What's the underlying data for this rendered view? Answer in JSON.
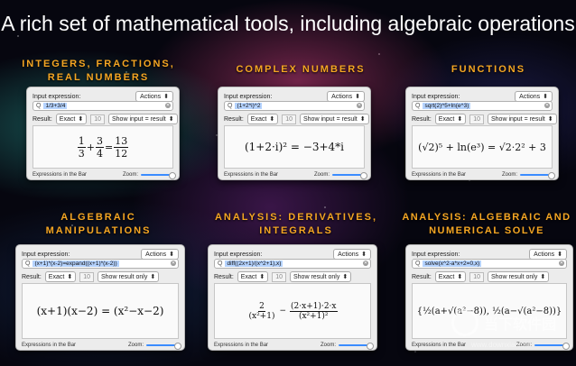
{
  "headline": "A rich set of mathematical tools, including algebraic operations",
  "common": {
    "input_label": "Input expression:",
    "actions_label": "Actions",
    "result_label": "Result:",
    "digits": "10",
    "expressions_in_bar": "Expressions in the Bar",
    "zoom_label": "Zoom:",
    "search_glyph": "Q",
    "clear_glyph": "✕",
    "dropdown_glyph": "⬍"
  },
  "sections": [
    {
      "label_line1": "INTEGERS, FRACTIONS,",
      "label_line2": "REAL NUMBERS",
      "input": "1/3+3/4",
      "result_mode": "Exact",
      "show_mode": "Show input = result",
      "output": {
        "f1_num": "1",
        "f1_den": "3",
        "op1": "+",
        "f2_num": "3",
        "f2_den": "4",
        "op2": "=",
        "f3_num": "13",
        "f3_den": "12"
      }
    },
    {
      "label_line1": "COMPLEX NUMBERS",
      "input": "(1+2*i)^2",
      "result_mode": "Exact",
      "show_mode": "Show input = result",
      "output_text": "(1+2·i)² = −3+4*i"
    },
    {
      "label_line1": "FUNCTIONS",
      "input": "sqrt(2)^5+ln(e^3)",
      "result_mode": "Exact",
      "show_mode": "Show input = result",
      "output_text": "(√2)⁵ + ln(e³) = √2·2² + 3"
    },
    {
      "label_line1": "ALGEBRAIC",
      "label_line2": "MANIPULATIONS",
      "input": "(x+1)*(x-2)=expand((x+1)*(x-2))",
      "result_mode": "Exact",
      "show_mode": "Show result only",
      "output_text": "(x+1)(x−2) = (x²−x−2)"
    },
    {
      "label_line1": "ANALYSIS: DERIVATIVES,",
      "label_line2": "INTEGRALS",
      "input": "diff((2x+1)/(x^2+1),x)",
      "result_mode": "Exact",
      "show_mode": "Show result only",
      "output": {
        "a_num": "2",
        "a_den": "(x²+1)",
        "minus": "−",
        "b_num": "(2·x+1)·2·x",
        "b_den": "(x²+1)²"
      }
    },
    {
      "label_line1": "ANALYSIS: ALGEBRAIC AND",
      "label_line2": "NUMERICAL SOLVE",
      "input": "solve(x^2-a*x+2=0,x)",
      "result_mode": "Exact",
      "show_mode": "Show result only",
      "output_text": "{½(a+√(a²−8)), ½(a−√(a²−8))}"
    }
  ],
  "watermark": {
    "text": "当下软件园",
    "url": "www.downxia.com"
  }
}
